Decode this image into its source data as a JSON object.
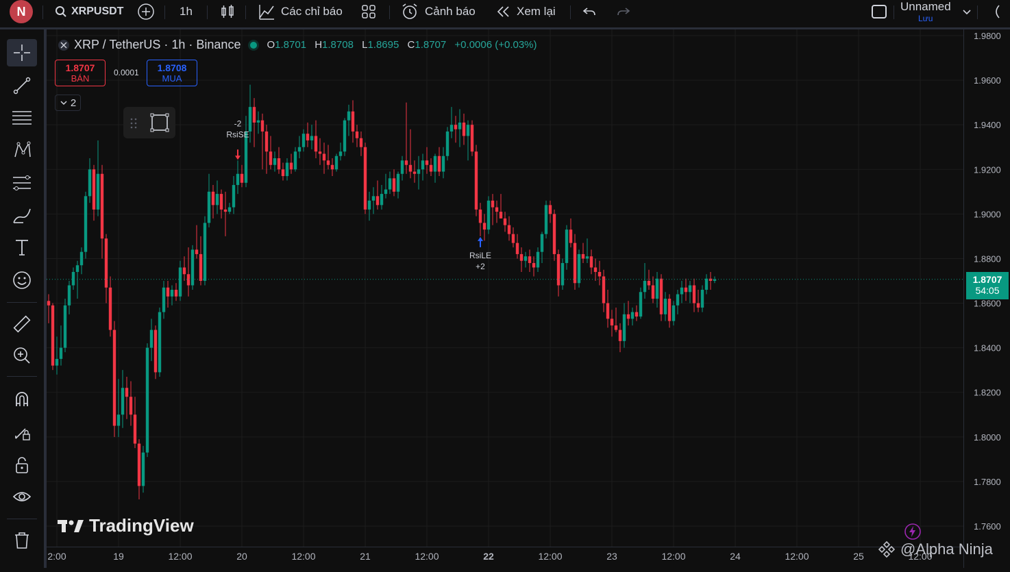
{
  "toolbar": {
    "avatar_letter": "N",
    "symbol": "XRPUSDT",
    "interval": "1h",
    "indicators_label": "Các chỉ báo",
    "alerts_label": "Cảnh báo",
    "replay_label": "Xem lại",
    "layout_name": "Unnamed",
    "layout_save": "Lưu"
  },
  "legend": {
    "title": "XRP / TetherUS · 1h · Binance",
    "o_label": "O",
    "o_value": "1.8701",
    "h_label": "H",
    "h_value": "1.8708",
    "l_label": "L",
    "l_value": "1.8695",
    "c_label": "C",
    "c_value": "1.8707",
    "change": "+0.0006 (+0.03%)"
  },
  "trade": {
    "sell_price": "1.8707",
    "sell_label": "BÁN",
    "spread": "0.0001",
    "buy_price": "1.8708",
    "buy_label": "MUA",
    "collapse_label": "2"
  },
  "last_price": {
    "value": "1.8707",
    "countdown": "54:05"
  },
  "branding": {
    "logo_text": "TradingView",
    "watermark": "@Alpha Ninja"
  },
  "colors": {
    "up": "#089981",
    "down": "#f23645",
    "buy_arrow": "#2962ff",
    "sell_arrow": "#f23645"
  },
  "icons": [
    "search-icon",
    "plus-circle-icon",
    "candles-icon",
    "indicators-icon",
    "templates-icon",
    "alarm-icon",
    "replay-icon",
    "undo-icon",
    "redo-icon",
    "crosshair-icon",
    "trendline-icon",
    "fib-icon",
    "pattern-icon",
    "prediction-icon",
    "brush-icon",
    "text-icon",
    "emoji-icon",
    "ruler-icon",
    "zoom-icon",
    "magnet-icon",
    "lock-pencil-icon",
    "lock-icon",
    "eye-icon",
    "trash-icon"
  ],
  "chart_data": {
    "type": "candlestick",
    "title": "XRP / TetherUS · 1h · Binance",
    "ylim": [
      1.755,
      1.985
    ],
    "y_ticks": [
      "1.9800",
      "1.9600",
      "1.9400",
      "1.9200",
      "1.9000",
      "1.8800",
      "1.8600",
      "1.8400",
      "1.8200",
      "1.8000",
      "1.7800",
      "1.7600"
    ],
    "x_ticks": [
      "2:00",
      "19",
      "12:00",
      "20",
      "12:00",
      "21",
      "12:00",
      "22",
      "12:00",
      "23",
      "12:00",
      "24",
      "12:00",
      "25",
      "12:00"
    ],
    "current_price": 1.8707,
    "signals": [
      {
        "label": "RsiSE",
        "qty": "-2",
        "direction": "sell",
        "index": 46
      },
      {
        "label": "RsiLE",
        "qty": "+2",
        "direction": "buy",
        "index": 105
      }
    ],
    "candles": [
      {
        "o": 1.861,
        "h": 1.864,
        "l": 1.851,
        "c": 1.859
      },
      {
        "o": 1.859,
        "h": 1.86,
        "l": 1.83,
        "c": 1.832
      },
      {
        "o": 1.832,
        "h": 1.845,
        "l": 1.828,
        "c": 1.835
      },
      {
        "o": 1.835,
        "h": 1.85,
        "l": 1.832,
        "c": 1.84
      },
      {
        "o": 1.84,
        "h": 1.862,
        "l": 1.838,
        "c": 1.859
      },
      {
        "o": 1.859,
        "h": 1.87,
        "l": 1.855,
        "c": 1.868
      },
      {
        "o": 1.868,
        "h": 1.876,
        "l": 1.866,
        "c": 1.874
      },
      {
        "o": 1.874,
        "h": 1.879,
        "l": 1.862,
        "c": 1.877
      },
      {
        "o": 1.877,
        "h": 1.885,
        "l": 1.873,
        "c": 1.883
      },
      {
        "o": 1.883,
        "h": 1.91,
        "l": 1.88,
        "c": 1.908
      },
      {
        "o": 1.908,
        "h": 1.925,
        "l": 1.905,
        "c": 1.92
      },
      {
        "o": 1.92,
        "h": 1.922,
        "l": 1.897,
        "c": 1.902
      },
      {
        "o": 1.902,
        "h": 1.933,
        "l": 1.899,
        "c": 1.918
      },
      {
        "o": 1.918,
        "h": 1.922,
        "l": 1.88,
        "c": 1.889
      },
      {
        "o": 1.889,
        "h": 1.891,
        "l": 1.86,
        "c": 1.867
      },
      {
        "o": 1.867,
        "h": 1.872,
        "l": 1.845,
        "c": 1.848
      },
      {
        "o": 1.848,
        "h": 1.852,
        "l": 1.8,
        "c": 1.805
      },
      {
        "o": 1.805,
        "h": 1.826,
        "l": 1.8,
        "c": 1.81
      },
      {
        "o": 1.81,
        "h": 1.83,
        "l": 1.804,
        "c": 1.822
      },
      {
        "o": 1.822,
        "h": 1.827,
        "l": 1.808,
        "c": 1.818
      },
      {
        "o": 1.818,
        "h": 1.825,
        "l": 1.805,
        "c": 1.81
      },
      {
        "o": 1.81,
        "h": 1.818,
        "l": 1.795,
        "c": 1.797
      },
      {
        "o": 1.797,
        "h": 1.799,
        "l": 1.772,
        "c": 1.778
      },
      {
        "o": 1.778,
        "h": 1.796,
        "l": 1.775,
        "c": 1.793
      },
      {
        "o": 1.793,
        "h": 1.842,
        "l": 1.791,
        "c": 1.84
      },
      {
        "o": 1.84,
        "h": 1.853,
        "l": 1.834,
        "c": 1.848
      },
      {
        "o": 1.848,
        "h": 1.85,
        "l": 1.826,
        "c": 1.829
      },
      {
        "o": 1.829,
        "h": 1.858,
        "l": 1.827,
        "c": 1.856
      },
      {
        "o": 1.856,
        "h": 1.87,
        "l": 1.853,
        "c": 1.867
      },
      {
        "o": 1.867,
        "h": 1.87,
        "l": 1.858,
        "c": 1.863
      },
      {
        "o": 1.863,
        "h": 1.868,
        "l": 1.859,
        "c": 1.866
      },
      {
        "o": 1.866,
        "h": 1.869,
        "l": 1.861,
        "c": 1.863
      },
      {
        "o": 1.863,
        "h": 1.879,
        "l": 1.861,
        "c": 1.876
      },
      {
        "o": 1.876,
        "h": 1.881,
        "l": 1.87,
        "c": 1.873
      },
      {
        "o": 1.873,
        "h": 1.885,
        "l": 1.863,
        "c": 1.868
      },
      {
        "o": 1.868,
        "h": 1.886,
        "l": 1.866,
        "c": 1.884
      },
      {
        "o": 1.884,
        "h": 1.895,
        "l": 1.88,
        "c": 1.882
      },
      {
        "o": 1.882,
        "h": 1.89,
        "l": 1.868,
        "c": 1.87
      },
      {
        "o": 1.87,
        "h": 1.899,
        "l": 1.868,
        "c": 1.896
      },
      {
        "o": 1.896,
        "h": 1.918,
        "l": 1.894,
        "c": 1.91
      },
      {
        "o": 1.91,
        "h": 1.913,
        "l": 1.898,
        "c": 1.904
      },
      {
        "o": 1.904,
        "h": 1.915,
        "l": 1.9,
        "c": 1.909
      },
      {
        "o": 1.909,
        "h": 1.911,
        "l": 1.898,
        "c": 1.902
      },
      {
        "o": 1.902,
        "h": 1.91,
        "l": 1.89,
        "c": 1.901
      },
      {
        "o": 1.901,
        "h": 1.905,
        "l": 1.9,
        "c": 1.903
      },
      {
        "o": 1.903,
        "h": 1.917,
        "l": 1.9,
        "c": 1.913
      },
      {
        "o": 1.913,
        "h": 1.924,
        "l": 1.909,
        "c": 1.918
      },
      {
        "o": 1.918,
        "h": 1.922,
        "l": 1.912,
        "c": 1.914
      },
      {
        "o": 1.914,
        "h": 1.944,
        "l": 1.912,
        "c": 1.937
      },
      {
        "o": 1.937,
        "h": 1.958,
        "l": 1.932,
        "c": 1.948
      },
      {
        "o": 1.948,
        "h": 1.952,
        "l": 1.93,
        "c": 1.941
      },
      {
        "o": 1.941,
        "h": 1.946,
        "l": 1.936,
        "c": 1.942
      },
      {
        "o": 1.942,
        "h": 1.945,
        "l": 1.92,
        "c": 1.937
      },
      {
        "o": 1.937,
        "h": 1.94,
        "l": 1.918,
        "c": 1.928
      },
      {
        "o": 1.928,
        "h": 1.935,
        "l": 1.92,
        "c": 1.922
      },
      {
        "o": 1.922,
        "h": 1.928,
        "l": 1.919,
        "c": 1.925
      },
      {
        "o": 1.925,
        "h": 1.93,
        "l": 1.918,
        "c": 1.92
      },
      {
        "o": 1.92,
        "h": 1.923,
        "l": 1.915,
        "c": 1.917
      },
      {
        "o": 1.917,
        "h": 1.925,
        "l": 1.915,
        "c": 1.923
      },
      {
        "o": 1.923,
        "h": 1.927,
        "l": 1.918,
        "c": 1.92
      },
      {
        "o": 1.92,
        "h": 1.93,
        "l": 1.919,
        "c": 1.928
      },
      {
        "o": 1.928,
        "h": 1.935,
        "l": 1.925,
        "c": 1.93
      },
      {
        "o": 1.93,
        "h": 1.938,
        "l": 1.928,
        "c": 1.936
      },
      {
        "o": 1.936,
        "h": 1.941,
        "l": 1.93,
        "c": 1.933
      },
      {
        "o": 1.933,
        "h": 1.94,
        "l": 1.929,
        "c": 1.935
      },
      {
        "o": 1.935,
        "h": 1.942,
        "l": 1.925,
        "c": 1.928
      },
      {
        "o": 1.928,
        "h": 1.934,
        "l": 1.922,
        "c": 1.927
      },
      {
        "o": 1.927,
        "h": 1.932,
        "l": 1.918,
        "c": 1.924
      },
      {
        "o": 1.924,
        "h": 1.931,
        "l": 1.92,
        "c": 1.922
      },
      {
        "o": 1.922,
        "h": 1.925,
        "l": 1.917,
        "c": 1.92
      },
      {
        "o": 1.92,
        "h": 1.927,
        "l": 1.919,
        "c": 1.926
      },
      {
        "o": 1.926,
        "h": 1.932,
        "l": 1.924,
        "c": 1.928
      },
      {
        "o": 1.928,
        "h": 1.943,
        "l": 1.926,
        "c": 1.942
      },
      {
        "o": 1.942,
        "h": 1.949,
        "l": 1.935,
        "c": 1.946
      },
      {
        "o": 1.946,
        "h": 1.951,
        "l": 1.932,
        "c": 1.937
      },
      {
        "o": 1.937,
        "h": 1.94,
        "l": 1.93,
        "c": 1.934
      },
      {
        "o": 1.934,
        "h": 1.937,
        "l": 1.926,
        "c": 1.93
      },
      {
        "o": 1.93,
        "h": 1.932,
        "l": 1.9,
        "c": 1.902
      },
      {
        "o": 1.902,
        "h": 1.91,
        "l": 1.897,
        "c": 1.906
      },
      {
        "o": 1.906,
        "h": 1.912,
        "l": 1.9,
        "c": 1.908
      },
      {
        "o": 1.908,
        "h": 1.915,
        "l": 1.902,
        "c": 1.904
      },
      {
        "o": 1.904,
        "h": 1.913,
        "l": 1.902,
        "c": 1.909
      },
      {
        "o": 1.909,
        "h": 1.918,
        "l": 1.907,
        "c": 1.911
      },
      {
        "o": 1.911,
        "h": 1.919,
        "l": 1.909,
        "c": 1.916
      },
      {
        "o": 1.916,
        "h": 1.92,
        "l": 1.908,
        "c": 1.91
      },
      {
        "o": 1.91,
        "h": 1.919,
        "l": 1.907,
        "c": 1.918
      },
      {
        "o": 1.918,
        "h": 1.926,
        "l": 1.915,
        "c": 1.924
      },
      {
        "o": 1.924,
        "h": 1.95,
        "l": 1.918,
        "c": 1.922
      },
      {
        "o": 1.922,
        "h": 1.938,
        "l": 1.916,
        "c": 1.919
      },
      {
        "o": 1.919,
        "h": 1.924,
        "l": 1.914,
        "c": 1.918
      },
      {
        "o": 1.918,
        "h": 1.926,
        "l": 1.911,
        "c": 1.92
      },
      {
        "o": 1.92,
        "h": 1.927,
        "l": 1.915,
        "c": 1.924
      },
      {
        "o": 1.924,
        "h": 1.93,
        "l": 1.918,
        "c": 1.922
      },
      {
        "o": 1.922,
        "h": 1.925,
        "l": 1.917,
        "c": 1.919
      },
      {
        "o": 1.919,
        "h": 1.927,
        "l": 1.914,
        "c": 1.926
      },
      {
        "o": 1.926,
        "h": 1.93,
        "l": 1.917,
        "c": 1.919
      },
      {
        "o": 1.919,
        "h": 1.93,
        "l": 1.916,
        "c": 1.926
      },
      {
        "o": 1.926,
        "h": 1.939,
        "l": 1.924,
        "c": 1.937
      },
      {
        "o": 1.937,
        "h": 1.948,
        "l": 1.934,
        "c": 1.94
      },
      {
        "o": 1.94,
        "h": 1.944,
        "l": 1.932,
        "c": 1.938
      },
      {
        "o": 1.938,
        "h": 1.947,
        "l": 1.93,
        "c": 1.941
      },
      {
        "o": 1.941,
        "h": 1.945,
        "l": 1.931,
        "c": 1.935
      },
      {
        "o": 1.935,
        "h": 1.942,
        "l": 1.924,
        "c": 1.94
      },
      {
        "o": 1.94,
        "h": 1.942,
        "l": 1.926,
        "c": 1.928
      },
      {
        "o": 1.928,
        "h": 1.931,
        "l": 1.899,
        "c": 1.902
      },
      {
        "o": 1.902,
        "h": 1.905,
        "l": 1.89,
        "c": 1.896
      },
      {
        "o": 1.896,
        "h": 1.9,
        "l": 1.888,
        "c": 1.893
      },
      {
        "o": 1.893,
        "h": 1.908,
        "l": 1.891,
        "c": 1.906
      },
      {
        "o": 1.906,
        "h": 1.909,
        "l": 1.895,
        "c": 1.903
      },
      {
        "o": 1.903,
        "h": 1.906,
        "l": 1.896,
        "c": 1.901
      },
      {
        "o": 1.901,
        "h": 1.909,
        "l": 1.898,
        "c": 1.898
      },
      {
        "o": 1.898,
        "h": 1.901,
        "l": 1.892,
        "c": 1.895
      },
      {
        "o": 1.895,
        "h": 1.899,
        "l": 1.888,
        "c": 1.891
      },
      {
        "o": 1.891,
        "h": 1.894,
        "l": 1.885,
        "c": 1.887
      },
      {
        "o": 1.887,
        "h": 1.891,
        "l": 1.88,
        "c": 1.882
      },
      {
        "o": 1.882,
        "h": 1.885,
        "l": 1.874,
        "c": 1.879
      },
      {
        "o": 1.879,
        "h": 1.883,
        "l": 1.876,
        "c": 1.881
      },
      {
        "o": 1.881,
        "h": 1.884,
        "l": 1.874,
        "c": 1.878
      },
      {
        "o": 1.878,
        "h": 1.881,
        "l": 1.872,
        "c": 1.876
      },
      {
        "o": 1.876,
        "h": 1.885,
        "l": 1.874,
        "c": 1.883
      },
      {
        "o": 1.883,
        "h": 1.892,
        "l": 1.878,
        "c": 1.891
      },
      {
        "o": 1.891,
        "h": 1.906,
        "l": 1.889,
        "c": 1.904
      },
      {
        "o": 1.904,
        "h": 1.906,
        "l": 1.896,
        "c": 1.9
      },
      {
        "o": 1.9,
        "h": 1.902,
        "l": 1.879,
        "c": 1.882
      },
      {
        "o": 1.882,
        "h": 1.884,
        "l": 1.863,
        "c": 1.868
      },
      {
        "o": 1.868,
        "h": 1.88,
        "l": 1.866,
        "c": 1.878
      },
      {
        "o": 1.878,
        "h": 1.895,
        "l": 1.875,
        "c": 1.893
      },
      {
        "o": 1.893,
        "h": 1.898,
        "l": 1.885,
        "c": 1.887
      },
      {
        "o": 1.887,
        "h": 1.891,
        "l": 1.866,
        "c": 1.869
      },
      {
        "o": 1.869,
        "h": 1.884,
        "l": 1.867,
        "c": 1.882
      },
      {
        "o": 1.882,
        "h": 1.887,
        "l": 1.878,
        "c": 1.88
      },
      {
        "o": 1.88,
        "h": 1.889,
        "l": 1.878,
        "c": 1.881
      },
      {
        "o": 1.881,
        "h": 1.884,
        "l": 1.873,
        "c": 1.876
      },
      {
        "o": 1.876,
        "h": 1.88,
        "l": 1.87,
        "c": 1.874
      },
      {
        "o": 1.874,
        "h": 1.879,
        "l": 1.868,
        "c": 1.872
      },
      {
        "o": 1.872,
        "h": 1.875,
        "l": 1.856,
        "c": 1.86
      },
      {
        "o": 1.86,
        "h": 1.866,
        "l": 1.849,
        "c": 1.853
      },
      {
        "o": 1.853,
        "h": 1.857,
        "l": 1.845,
        "c": 1.85
      },
      {
        "o": 1.85,
        "h": 1.858,
        "l": 1.847,
        "c": 1.848
      },
      {
        "o": 1.848,
        "h": 1.851,
        "l": 1.838,
        "c": 1.843
      },
      {
        "o": 1.843,
        "h": 1.86,
        "l": 1.84,
        "c": 1.855
      },
      {
        "o": 1.855,
        "h": 1.861,
        "l": 1.85,
        "c": 1.853
      },
      {
        "o": 1.853,
        "h": 1.858,
        "l": 1.85,
        "c": 1.856
      },
      {
        "o": 1.856,
        "h": 1.859,
        "l": 1.852,
        "c": 1.854
      },
      {
        "o": 1.854,
        "h": 1.867,
        "l": 1.853,
        "c": 1.865
      },
      {
        "o": 1.865,
        "h": 1.878,
        "l": 1.862,
        "c": 1.87
      },
      {
        "o": 1.87,
        "h": 1.875,
        "l": 1.866,
        "c": 1.868
      },
      {
        "o": 1.868,
        "h": 1.872,
        "l": 1.86,
        "c": 1.862
      },
      {
        "o": 1.862,
        "h": 1.874,
        "l": 1.858,
        "c": 1.871
      },
      {
        "o": 1.871,
        "h": 1.873,
        "l": 1.852,
        "c": 1.855
      },
      {
        "o": 1.855,
        "h": 1.865,
        "l": 1.852,
        "c": 1.862
      },
      {
        "o": 1.862,
        "h": 1.864,
        "l": 1.849,
        "c": 1.852
      },
      {
        "o": 1.852,
        "h": 1.861,
        "l": 1.85,
        "c": 1.859
      },
      {
        "o": 1.859,
        "h": 1.866,
        "l": 1.855,
        "c": 1.864
      },
      {
        "o": 1.864,
        "h": 1.87,
        "l": 1.86,
        "c": 1.867
      },
      {
        "o": 1.867,
        "h": 1.871,
        "l": 1.861,
        "c": 1.865
      },
      {
        "o": 1.865,
        "h": 1.87,
        "l": 1.86,
        "c": 1.868
      },
      {
        "o": 1.868,
        "h": 1.871,
        "l": 1.856,
        "c": 1.86
      },
      {
        "o": 1.86,
        "h": 1.866,
        "l": 1.856,
        "c": 1.858
      },
      {
        "o": 1.858,
        "h": 1.868,
        "l": 1.856,
        "c": 1.866
      },
      {
        "o": 1.866,
        "h": 1.873,
        "l": 1.864,
        "c": 1.871
      },
      {
        "o": 1.871,
        "h": 1.874,
        "l": 1.866,
        "c": 1.87
      },
      {
        "o": 1.87,
        "h": 1.872,
        "l": 1.869,
        "c": 1.8707
      }
    ]
  }
}
